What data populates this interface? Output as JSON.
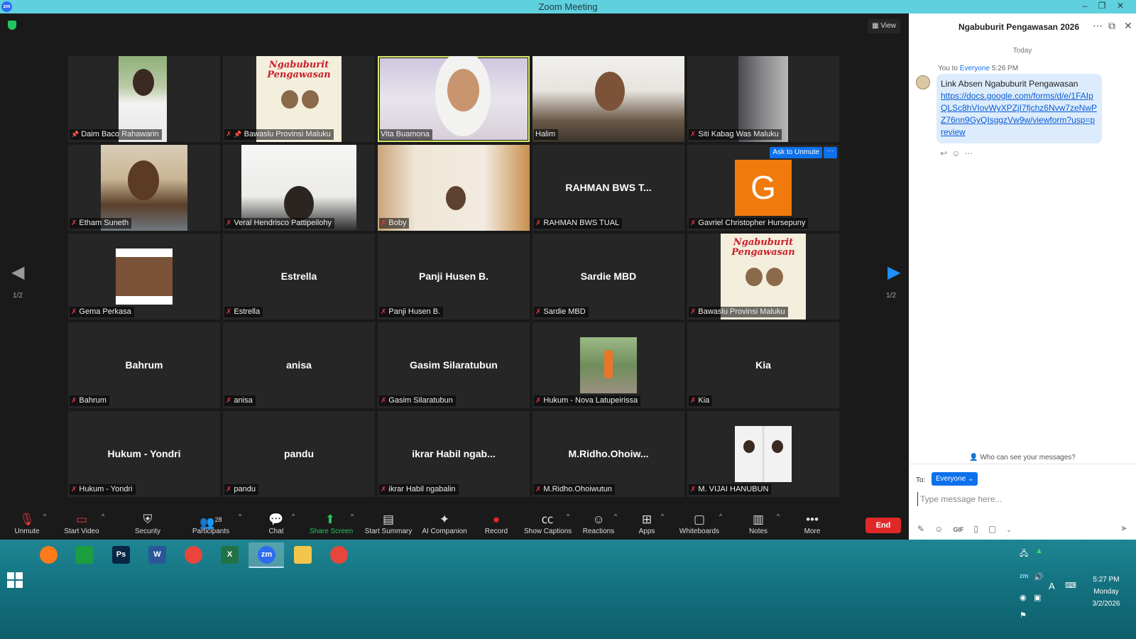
{
  "window": {
    "title": "Zoom Meeting",
    "app_icon": "zm",
    "controls": [
      "–",
      "❐",
      "✕"
    ]
  },
  "meeting": {
    "view_label": "View",
    "page_indicator_left": "1/2",
    "page_indicator_right": "1/2",
    "ask_to_unmute_label": "Ask to Unmute",
    "ask_more_label": "···",
    "logo_line1": "Ngabuburit",
    "logo_line2": "Pengawasan",
    "avatar_letter": "G",
    "tiles": [
      {
        "name": "Daim Baco Rahawarin",
        "center": "",
        "pinned": true
      },
      {
        "name": "Bawaslu Provinsi Maluku",
        "center": "",
        "pinned": true
      },
      {
        "name": "Vita Buamona",
        "center": "",
        "pinned": false
      },
      {
        "name": "Halim",
        "center": "",
        "pinned": false
      },
      {
        "name": "Siti Kabag Was Maluku",
        "center": "",
        "pinned": false
      },
      {
        "name": "Etham Suneth",
        "center": "",
        "pinned": false
      },
      {
        "name": "Veral Hendrisco Pattipeilohy",
        "center": "",
        "pinned": false
      },
      {
        "name": "Boby",
        "center": "",
        "pinned": false
      },
      {
        "name": "RAHMAN BWS TUAL",
        "center": "RAHMAN BWS T...",
        "pinned": false
      },
      {
        "name": "Gavriel Christopher Hursepuny",
        "center": "",
        "pinned": false
      },
      {
        "name": "Gema Perkasa",
        "center": "",
        "pinned": false
      },
      {
        "name": "Estrella",
        "center": "Estrella",
        "pinned": false
      },
      {
        "name": "Panji Husen B.",
        "center": "Panji Husen B.",
        "pinned": false
      },
      {
        "name": "Sardie MBD",
        "center": "Sardie MBD",
        "pinned": false
      },
      {
        "name": "Bawaslu Provinsi Maluku",
        "center": "",
        "pinned": false
      },
      {
        "name": "Bahrum",
        "center": "Bahrum",
        "pinned": false
      },
      {
        "name": "anisa",
        "center": "anisa",
        "pinned": false
      },
      {
        "name": "Gasim Silaratubun",
        "center": "Gasim Silaratubun",
        "pinned": false
      },
      {
        "name": "Hukum - Nova Latupeirissa",
        "center": "",
        "pinned": false
      },
      {
        "name": "Kia",
        "center": "Kia",
        "pinned": false
      },
      {
        "name": "Hukum - Yondri",
        "center": "Hukum - Yondri",
        "pinned": false
      },
      {
        "name": "pandu",
        "center": "pandu",
        "pinned": false
      },
      {
        "name": "ikrar Habil ngabalin",
        "center": "ikrar Habil ngab...",
        "pinned": false
      },
      {
        "name": "M.Ridho.Ohoiwutun",
        "center": "M.Ridho.Ohoiw...",
        "pinned": false
      },
      {
        "name": "M. VIJAI HANUBUN",
        "center": "",
        "pinned": false
      }
    ]
  },
  "toolbar": {
    "unmute": "Unmute",
    "start_video": "Start Video",
    "security": "Security",
    "participants": "Participants",
    "participants_count": "28",
    "chat": "Chat",
    "share_screen": "Share Screen",
    "start_summary": "Start Summary",
    "ai_companion": "AI Companion",
    "record": "Record",
    "show_captions": "Show Captions",
    "reactions": "Reactions",
    "apps": "Apps",
    "whiteboards": "Whiteboards",
    "notes": "Notes",
    "more": "More",
    "end": "End"
  },
  "chat": {
    "title": "Ngabuburit Pengawasan 2026",
    "date_divider": "Today",
    "message": {
      "sender": "You to ",
      "recipient": "Everyone",
      "time": "5:26 PM",
      "text": "Link Absen Ngabuburit Pengawasan",
      "link": "https://docs.google.com/forms/d/e/1FAIpQLSc8hVIovWyXPZjI7fjchz6Nvw7zeNwPZ76nn9GyQIsggzVw9w/viewform?usp=preview"
    },
    "who_can_see": "Who can see your messages?",
    "to_label": "To:",
    "to_value": "Everyone",
    "input_placeholder": "Type message here..."
  },
  "taskbar": {
    "apps": [
      {
        "name": "firefox",
        "label": "",
        "color": "#ff7a18"
      },
      {
        "name": "store",
        "label": "",
        "color": "#1b9e3e"
      },
      {
        "name": "photoshop",
        "label": "Ps",
        "color": "#0b2545"
      },
      {
        "name": "word",
        "label": "W",
        "color": "#2b579a"
      },
      {
        "name": "chrome",
        "label": "",
        "color": "#e8453c"
      },
      {
        "name": "excel",
        "label": "X",
        "color": "#217346"
      },
      {
        "name": "zoom",
        "label": "zm",
        "color": "#2d6cf0"
      },
      {
        "name": "file-explorer",
        "label": "",
        "color": "#f3c54a"
      },
      {
        "name": "chrome-2",
        "label": "",
        "color": "#e8453c"
      }
    ],
    "clock_time": "5:27 PM",
    "clock_day": "Monday",
    "clock_date": "3/2/2026"
  },
  "colors": {
    "accent": "#0e71eb",
    "muted_mic": "#e0393e",
    "end": "#e02828",
    "share": "#23c55e",
    "active_speaker": "#d9e86a"
  }
}
